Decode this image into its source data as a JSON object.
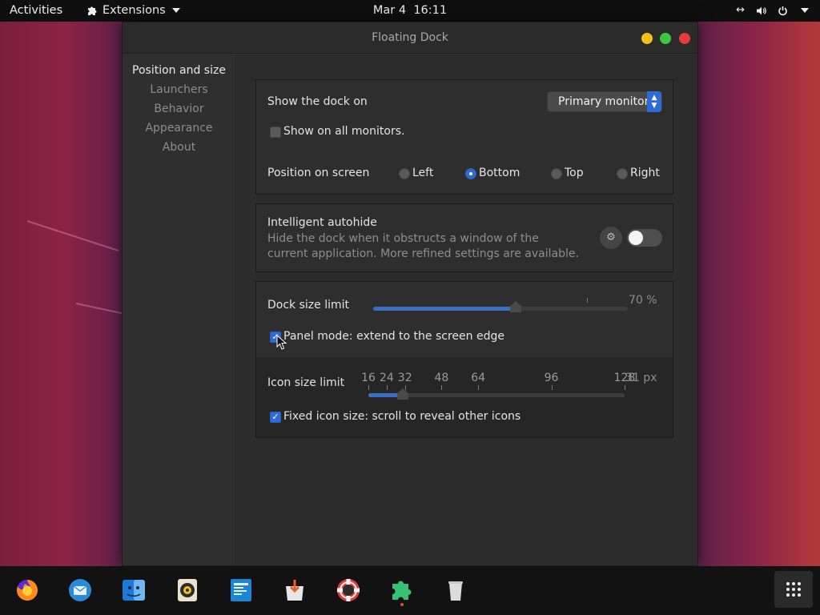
{
  "topbar": {
    "activities": "Activities",
    "extensions": "Extensions",
    "date": "Mar 4",
    "time": "16:11"
  },
  "window": {
    "title": "Floating Dock"
  },
  "sidebar": {
    "items": [
      {
        "label": "Position and size",
        "active": true
      },
      {
        "label": "Launchers",
        "active": false
      },
      {
        "label": "Behavior",
        "active": false
      },
      {
        "label": "Appearance",
        "active": false
      },
      {
        "label": "About",
        "active": false
      }
    ]
  },
  "position_section": {
    "show_dock_on_label": "Show the dock on",
    "monitor_select_value": "Primary monitor",
    "all_monitors_label": "Show on all monitors.",
    "all_monitors_checked": false,
    "position_label": "Position on screen",
    "positions": [
      {
        "label": "Left",
        "selected": false
      },
      {
        "label": "Bottom",
        "selected": true
      },
      {
        "label": "Top",
        "selected": false
      },
      {
        "label": "Right",
        "selected": false
      }
    ]
  },
  "autohide_section": {
    "title": "Intelligent autohide",
    "description": "Hide the dock when it obstructs a window of the current application. More refined settings are available.",
    "enabled": false
  },
  "size_section": {
    "dock_size_label": "Dock size limit",
    "dock_size_value": "70 %",
    "dock_size_fraction": 0.7,
    "panel_mode_label": "Panel mode: extend to the screen edge",
    "panel_mode_checked": true,
    "icon_size_label": "Icon size limit",
    "icon_size_marks": [
      "16",
      "24",
      "32",
      "48",
      "64",
      "96",
      "128"
    ],
    "icon_size_value": "31 px",
    "icon_size_px": 31,
    "fixed_icon_label": "Fixed icon size: scroll to reveal other icons",
    "fixed_icon_checked": true
  },
  "dock": {
    "apps": [
      {
        "name": "firefox-icon"
      },
      {
        "name": "thunderbird-icon"
      },
      {
        "name": "files-icon"
      },
      {
        "name": "rhythmbox-icon"
      },
      {
        "name": "writer-icon"
      },
      {
        "name": "software-icon"
      },
      {
        "name": "help-icon"
      },
      {
        "name": "extensions-icon",
        "running": true
      },
      {
        "name": "trash-icon"
      }
    ],
    "show_apps": "show-applications-icon"
  },
  "colors": {
    "accent": "#2f6bd6",
    "close": "#ea3b3b",
    "minimize": "#f3c116",
    "maximize": "#3cc83c"
  }
}
